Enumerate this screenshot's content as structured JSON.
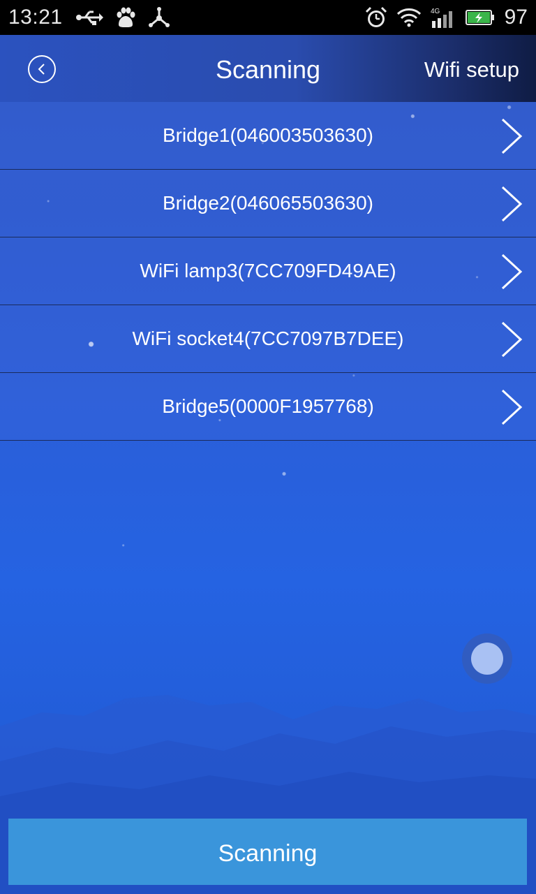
{
  "status_bar": {
    "time": "13:21",
    "battery_level": "97",
    "network_label": "4G",
    "icons_left": [
      "usb-icon",
      "baidu-paw-icon",
      "share-icon"
    ],
    "icons_right": [
      "alarm-clock-icon",
      "wifi-icon",
      "signal-icon",
      "battery-charging-icon"
    ],
    "battery_color": "#3bb54a"
  },
  "header": {
    "title": "Scanning",
    "right_action": "Wifi setup",
    "back_icon": "back-circle-icon"
  },
  "devices": [
    {
      "label": "Bridge1(046003503630)"
    },
    {
      "label": "Bridge2(046065503630)"
    },
    {
      "label": "WiFi lamp3(7CC709FD49AE)"
    },
    {
      "label": "WiFi socket4(7CC7097B7DEE)"
    },
    {
      "label": "Bridge5(0000F1957768)"
    }
  ],
  "bottom_button": {
    "label": "Scanning",
    "color": "#3a95db"
  }
}
